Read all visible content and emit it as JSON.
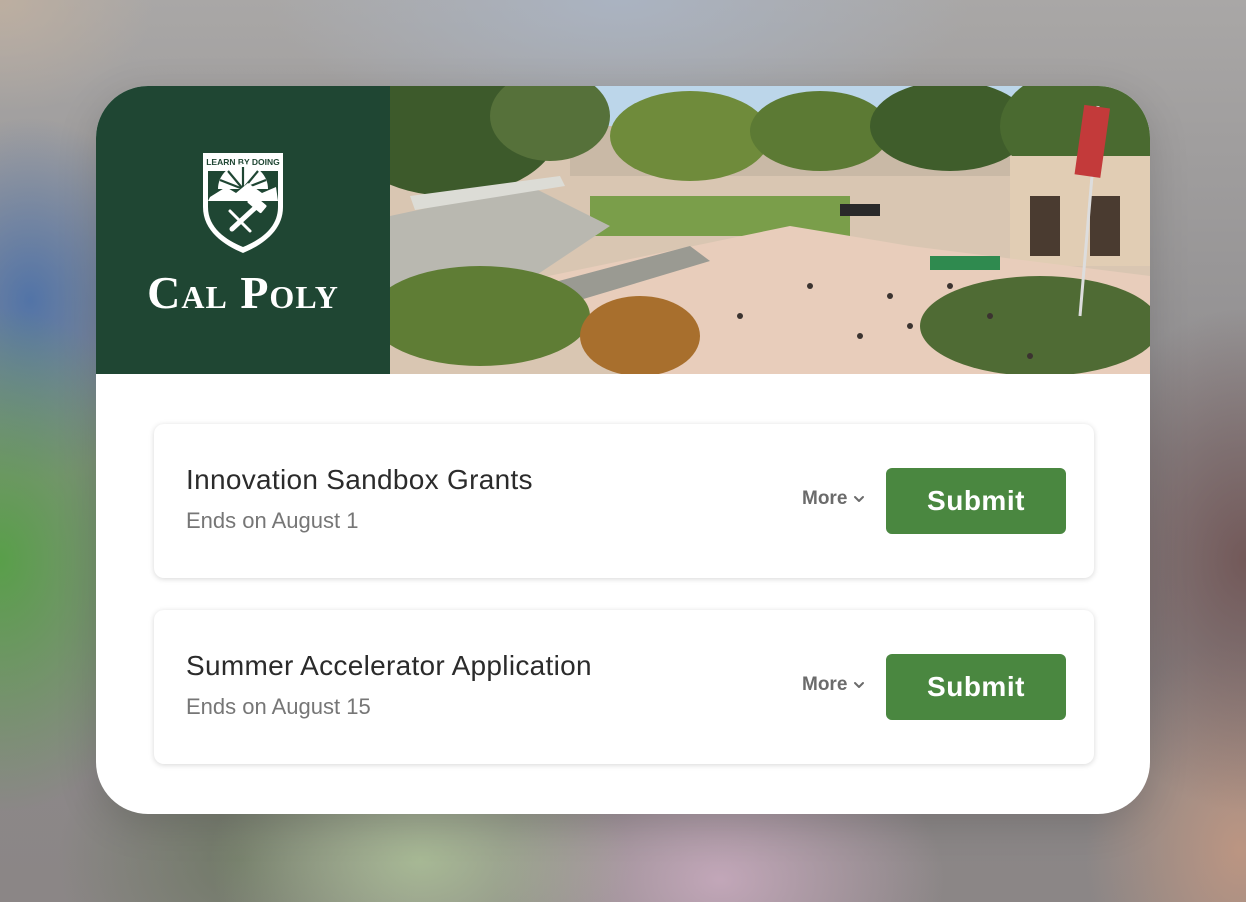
{
  "brand": {
    "motto": "LEARN BY DOING",
    "name": "Cal Poly",
    "logo_icon": "shield-crest-icon",
    "panel_color": "#1f4633"
  },
  "header": {
    "photo": "campus-plaza-photo"
  },
  "items": [
    {
      "title": "Innovation Sandbox Grants",
      "subtitle": "Ends on August 1",
      "more_label": "More",
      "submit_label": "Submit"
    },
    {
      "title": "Summer Accelerator Application",
      "subtitle": "Ends on August 15",
      "more_label": "More",
      "submit_label": "Submit"
    }
  ],
  "colors": {
    "accent": "#4a8740",
    "brand": "#1f4633"
  }
}
